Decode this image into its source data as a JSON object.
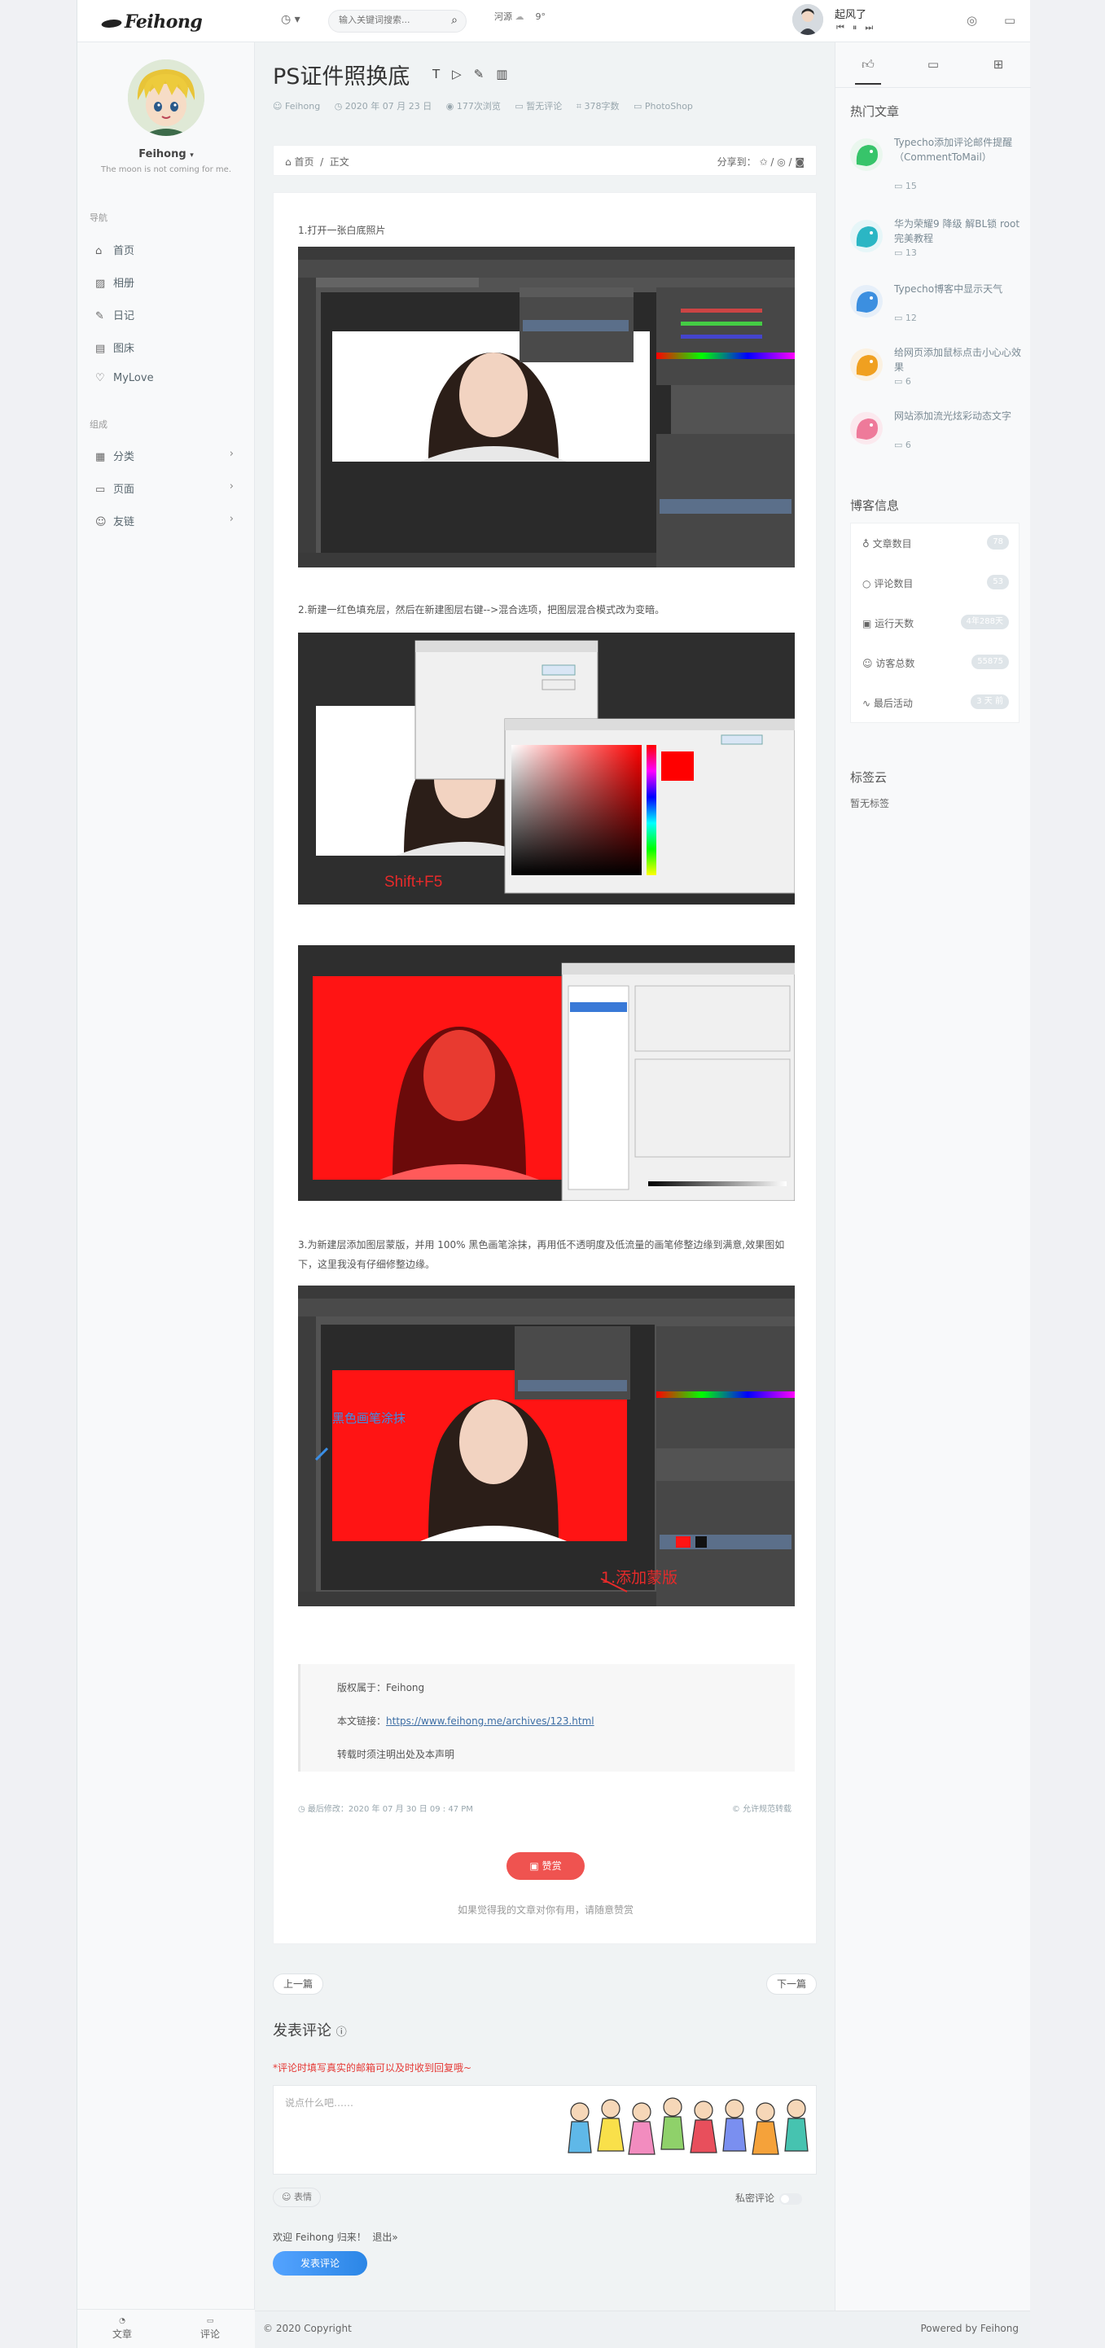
{
  "header": {
    "logo": "Feihong",
    "search_placeholder": "输入关键词搜索...",
    "weather_city": "河源",
    "weather_temp": "9°",
    "song_title": "起风了"
  },
  "left": {
    "name": "Feihong",
    "motto": "The moon is not coming for me.",
    "nav_heading": "导航",
    "nav": [
      {
        "label": "首页"
      },
      {
        "label": "相册"
      },
      {
        "label": "日记"
      },
      {
        "label": "图床"
      },
      {
        "label": "MyLove"
      }
    ],
    "group_heading": "组成",
    "groups": [
      {
        "label": "分类"
      },
      {
        "label": "页面"
      },
      {
        "label": "友链"
      }
    ],
    "bottom_articles": "文章",
    "bottom_comments": "评论"
  },
  "post": {
    "title": "PS证件照换底",
    "author": "Feihong",
    "date": "2020 年 07 月 23 日",
    "views": "177次浏览",
    "comments": "暂无评论",
    "words": "378字数",
    "category": "PhotoShop",
    "bread_home": "首页",
    "bread_current": "正文",
    "share_label": "分享到：",
    "step1": "1.打开一张白底照片",
    "step2": "2.新建一红色填充层，然后在新建图层右键-->混合选项，把图层混合模式改为变暗。",
    "step3": "3.为新建层添加图层蒙版，并用 100% 黑色画笔涂抹，再用低不透明度及低流量的画笔修整边缘到满意,效果图如下，这里我没有仔细修整边缘。",
    "shift_f5": "Shift+F5",
    "brush_note": "黑色画笔涂抹",
    "mask_note": "1.添加蒙版",
    "copyright_owner": "版权属于：Feihong",
    "link_label": "本文链接：",
    "link_url": "https://www.feihong.me/archives/123.html",
    "repost_note": "转载时须注明出处及本声明",
    "last_modified": "最后修改：2020 年 07 月 30 日 09 : 47 PM",
    "license": "© 允许规范转载",
    "reward_label": "赞赏",
    "reward_tip": "如果觉得我的文章对你有用，请随意赞赏",
    "prev": "上一篇",
    "next": "下一篇"
  },
  "comment": {
    "title": "发表评论",
    "warn": "*评论时填写真实的邮箱可以及时收到回复哦~",
    "placeholder": "说点什么吧……",
    "emoji": "表情",
    "private": "私密评论",
    "welcome": "欢迎 Feihong 归来！",
    "logout": "退出»",
    "submit": "发表评论"
  },
  "footer": {
    "copyright": "© 2020 Copyright",
    "powered": "Powered by Feihong"
  },
  "right": {
    "hot_heading": "热门文章",
    "hot": [
      {
        "title": "Typecho添加评论邮件提醒（CommentToMail）",
        "count": "15",
        "color": "#37c46a"
      },
      {
        "title": "华为荣耀9 降级 解BL锁 root完美教程",
        "count": "13",
        "color": "#2bb6c4"
      },
      {
        "title": "Typecho博客中显示天气",
        "count": "12",
        "color": "#3c8fe0"
      },
      {
        "title": "给网页添加鼠标点击小心心效果",
        "count": "6",
        "color": "#f0a020"
      },
      {
        "title": "网站添加流光炫彩动态文字",
        "count": "6",
        "color": "#ee7a9a"
      }
    ],
    "info_heading": "博客信息",
    "stats": [
      {
        "label": "文章数目",
        "value": "78"
      },
      {
        "label": "评论数目",
        "value": "53"
      },
      {
        "label": "运行天数",
        "value": "4年288天"
      },
      {
        "label": "访客总数",
        "value": "55875"
      },
      {
        "label": "最后活动",
        "value": "3 天 前"
      }
    ],
    "tag_heading": "标签云",
    "tag_empty": "暂无标签"
  }
}
